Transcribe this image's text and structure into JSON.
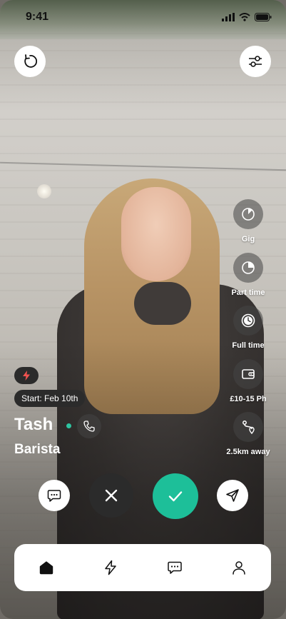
{
  "status_bar": {
    "time": "9:41"
  },
  "top_actions": {
    "reload_icon": "reload-icon",
    "filters_icon": "sliders-icon"
  },
  "rail": [
    {
      "label": "Gig",
      "icon": "gig-clock-icon"
    },
    {
      "label": "Part time",
      "icon": "part-time-clock-icon"
    },
    {
      "label": "Full time",
      "icon": "full-time-clock-icon"
    },
    {
      "label": "£10-15 Ph",
      "icon": "wallet-icon"
    },
    {
      "label": "2.5km away",
      "icon": "route-icon"
    }
  ],
  "profile": {
    "badge_icon": "bolt-icon",
    "start": "Start: Feb 10th",
    "name": "Tash",
    "online": true,
    "role": "Barista"
  },
  "actions": [
    "chat-icon",
    "close-icon",
    "check-icon",
    "send-icon"
  ],
  "colors": {
    "accent": "#1dbf99",
    "dark": "#2b2b2b",
    "online": "#2ec4a1",
    "badge_bolt": "#f0524f"
  },
  "nav": [
    "home-icon",
    "bolt-icon",
    "chat-icon",
    "profile-icon"
  ]
}
